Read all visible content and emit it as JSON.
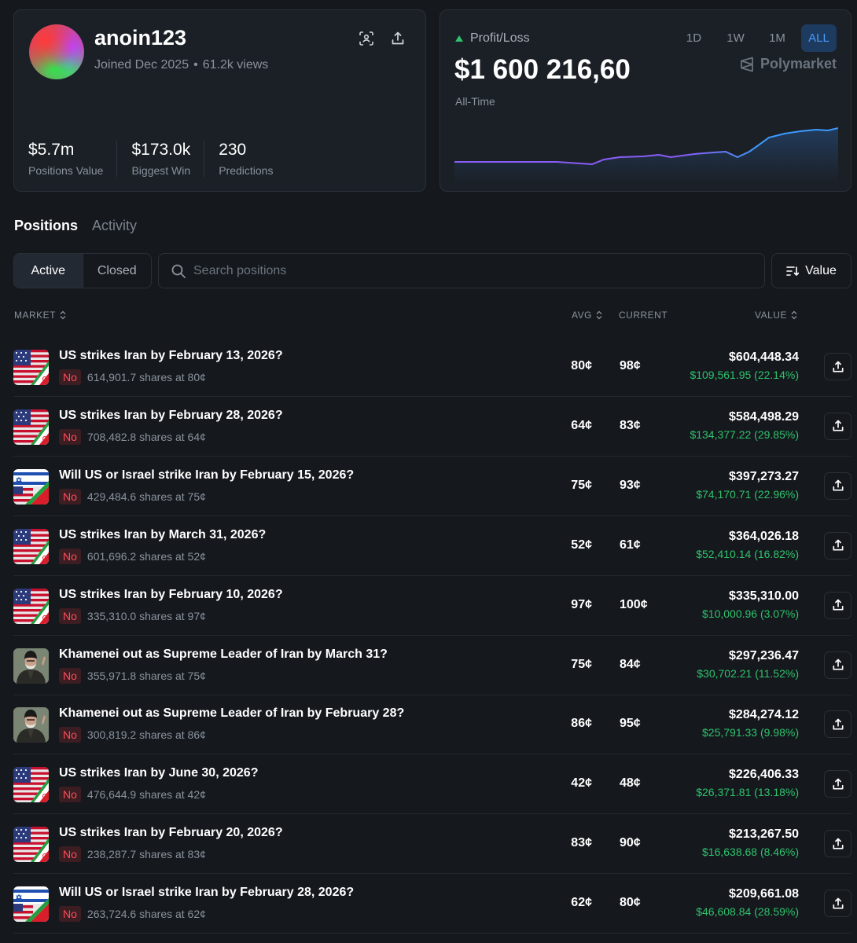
{
  "profile": {
    "username": "anoin123",
    "joined": "Joined Dec 2025",
    "separator": "•",
    "views": "61.2k views",
    "stats": [
      {
        "value": "$5.7m",
        "label": "Positions Value"
      },
      {
        "value": "$173.0k",
        "label": "Biggest Win"
      },
      {
        "value": "230",
        "label": "Predictions"
      }
    ]
  },
  "pnl": {
    "label": "Profit/Loss",
    "value": "$1 600 216,60",
    "period": "All-Time",
    "ranges": [
      "1D",
      "1W",
      "1M",
      "ALL"
    ],
    "active_range": "ALL",
    "brand": "Polymarket",
    "colors": {
      "positive": "#2fc26b",
      "line_start": "#8a5cf6",
      "line_end": "#3b9bff",
      "active_tab": "#4a9bff"
    }
  },
  "tabs": {
    "positions": "Positions",
    "activity": "Activity"
  },
  "filters": {
    "active": "Active",
    "closed": "Closed",
    "search_placeholder": "Search positions",
    "sort_label": "Value"
  },
  "table": {
    "headers": {
      "market": "MARKET",
      "avg": "AVG",
      "current": "CURRENT",
      "value": "VALUE"
    },
    "rows": [
      {
        "icon": "us-iran-flag-icon",
        "title": "US strikes Iran by February 13, 2026?",
        "outcome": "No",
        "shares": "614,901.7 shares at 80¢",
        "avg": "80¢",
        "current": "98¢",
        "value": "$604,448.34",
        "pnl": "$109,561.95 (22.14%)"
      },
      {
        "icon": "us-iran-flag-icon",
        "title": "US strikes Iran by February 28, 2026?",
        "outcome": "No",
        "shares": "708,482.8 shares at 64¢",
        "avg": "64¢",
        "current": "83¢",
        "value": "$584,498.29",
        "pnl": "$134,377.22 (29.85%)"
      },
      {
        "icon": "israel-us-iran-flag-icon",
        "title": "Will US or Israel strike Iran by February 15, 2026?",
        "outcome": "No",
        "shares": "429,484.6 shares at 75¢",
        "avg": "75¢",
        "current": "93¢",
        "value": "$397,273.27",
        "pnl": "$74,170.71 (22.96%)"
      },
      {
        "icon": "us-iran-flag-icon",
        "title": "US strikes Iran by March 31, 2026?",
        "outcome": "No",
        "shares": "601,696.2 shares at 52¢",
        "avg": "52¢",
        "current": "61¢",
        "value": "$364,026.18",
        "pnl": "$52,410.14 (16.82%)"
      },
      {
        "icon": "us-iran-flag-icon",
        "title": "US strikes Iran by February 10, 2026?",
        "outcome": "No",
        "shares": "335,310.0 shares at 97¢",
        "avg": "97¢",
        "current": "100¢",
        "value": "$335,310.00",
        "pnl": "$10,000.96 (3.07%)"
      },
      {
        "icon": "khamenei-portrait-icon",
        "title": "Khamenei out as Supreme Leader of Iran by March 31?",
        "outcome": "No",
        "shares": "355,971.8 shares at 75¢",
        "avg": "75¢",
        "current": "84¢",
        "value": "$297,236.47",
        "pnl": "$30,702.21 (11.52%)"
      },
      {
        "icon": "khamenei-portrait-icon",
        "title": "Khamenei out as Supreme Leader of Iran by February 28?",
        "outcome": "No",
        "shares": "300,819.2 shares at 86¢",
        "avg": "86¢",
        "current": "95¢",
        "value": "$284,274.12",
        "pnl": "$25,791.33 (9.98%)"
      },
      {
        "icon": "us-iran-flag-icon",
        "title": "US strikes Iran by June 30, 2026?",
        "outcome": "No",
        "shares": "476,644.9 shares at 42¢",
        "avg": "42¢",
        "current": "48¢",
        "value": "$226,406.33",
        "pnl": "$26,371.81 (13.18%)"
      },
      {
        "icon": "us-iran-flag-icon",
        "title": "US strikes Iran by February 20, 2026?",
        "outcome": "No",
        "shares": "238,287.7 shares at 83¢",
        "avg": "83¢",
        "current": "90¢",
        "value": "$213,267.50",
        "pnl": "$16,638.68 (8.46%)"
      },
      {
        "icon": "israel-us-iran-flag-icon",
        "title": "Will US or Israel strike Iran by February 28, 2026?",
        "outcome": "No",
        "shares": "263,724.6 shares at 62¢",
        "avg": "62¢",
        "current": "80¢",
        "value": "$209,661.08",
        "pnl": "$46,608.84 (28.59%)"
      }
    ]
  }
}
